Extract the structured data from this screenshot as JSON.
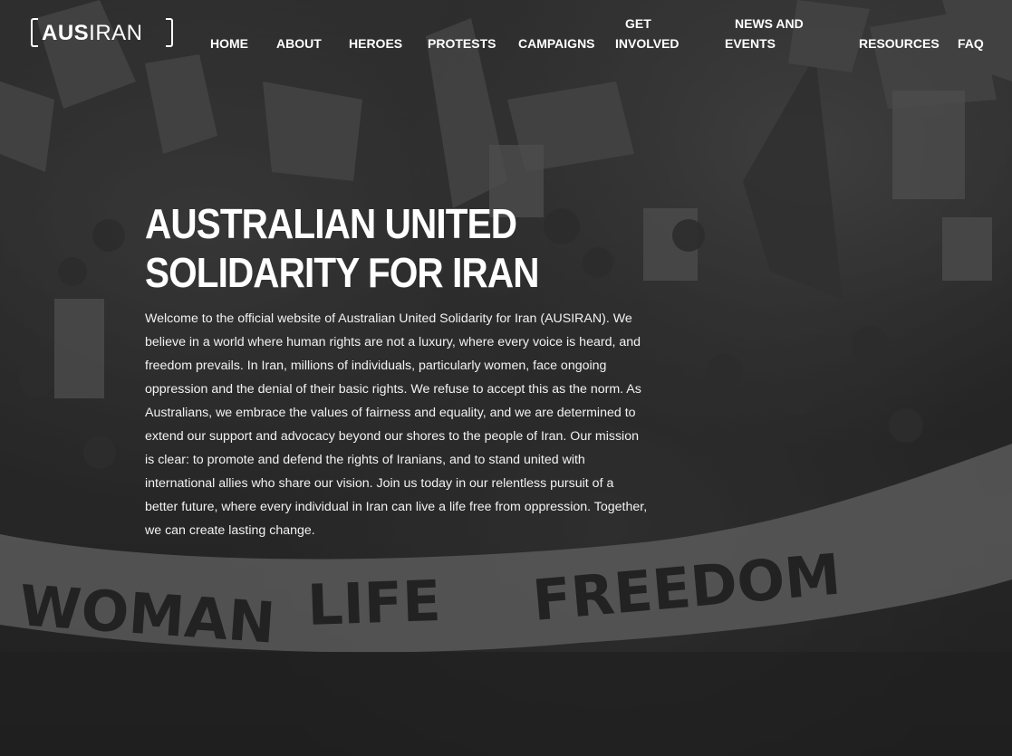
{
  "brand": {
    "logo_bold": "AUS",
    "logo_light": "IRAN"
  },
  "nav": {
    "home": "HOME",
    "about": "ABOUT",
    "heroes": "HEROES",
    "protests": "PROTESTS",
    "campaigns": "CAMPAIGNS",
    "get_involved_1": "GET",
    "get_involved_2": "INVOLVED",
    "news_1": "NEWS AND",
    "news_2": "EVENTS",
    "resources": "RESOURCES",
    "faq": "FAQ"
  },
  "hero": {
    "title_line1": "AUSTRALIAN UNITED",
    "title_line2": "SOLIDARITY FOR IRAN",
    "intro": "Welcome to the official website of Australian United Solidarity for Iran (AUSIRAN). We believe in a world where human rights are not a luxury, where every voice is heard, and freedom prevails. In Iran, millions of individuals, particularly women, face ongoing oppression and the denial of their basic rights. We refuse to accept this as the norm. As Australians, we embrace the values of fairness and equality, and we are determined to extend our support and advocacy beyond our shores to the people of Iran. Our mission is clear: to promote and defend the rights of Iranians, and to stand united with international allies who share our vision. Join us today in our relentless pursuit of a better future, where every individual in Iran can live a life free from oppression. Together, we can create lasting change."
  },
  "banner": {
    "word1": "WOMAN",
    "word2": "LIFE",
    "word3": "FREEDOM"
  }
}
